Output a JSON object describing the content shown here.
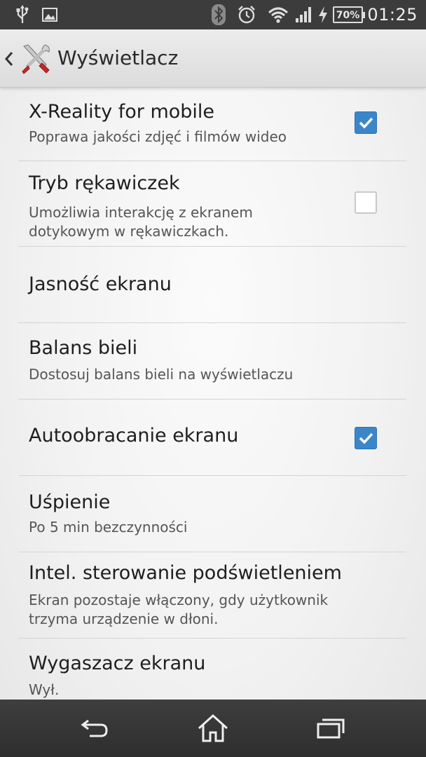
{
  "status_bar": {
    "left_icons": [
      "usb-icon",
      "image-icon"
    ],
    "right_icons": [
      "bluetooth-icon",
      "alarm-icon",
      "wifi-icon",
      "signal-icon",
      "charging-icon",
      "battery-icon"
    ],
    "battery": "70%",
    "time": "01:25"
  },
  "header": {
    "title": "Wyświetlacz",
    "back_icon": "chevron-left-icon",
    "app_icon": "tools-icon"
  },
  "settings": [
    {
      "title": "X-Reality for mobile",
      "subtitle": "Poprawa jakości zdjęć i filmów wideo",
      "checkbox": true
    },
    {
      "title": "Tryb rękawiczek",
      "subtitle": "Umożliwia interakcję z ekranem dotykowym w rękawiczkach.",
      "checkbox": false
    },
    {
      "title": "Jasność ekranu"
    },
    {
      "title": "Balans bieli",
      "subtitle": "Dostosuj balans bieli na wyświetlaczu"
    },
    {
      "title": "Autoobracanie ekranu",
      "checkbox": true
    },
    {
      "title": "Uśpienie",
      "subtitle": "Po 5 min bezczynności"
    },
    {
      "title": "Intel. sterowanie podświetleniem",
      "subtitle": "Ekran pozostaje włączony, gdy użytkownik trzyma urządzenie w dłoni."
    },
    {
      "title": "Wygaszacz ekranu",
      "subtitle": "Wył."
    }
  ],
  "nav_bar": {
    "buttons": [
      "back-icon",
      "home-icon",
      "recent-apps-icon"
    ]
  },
  "colors": {
    "accent": "#3b86c9",
    "status_bar": "#3c3c3c",
    "nav_bar": "#2e2e2e"
  }
}
